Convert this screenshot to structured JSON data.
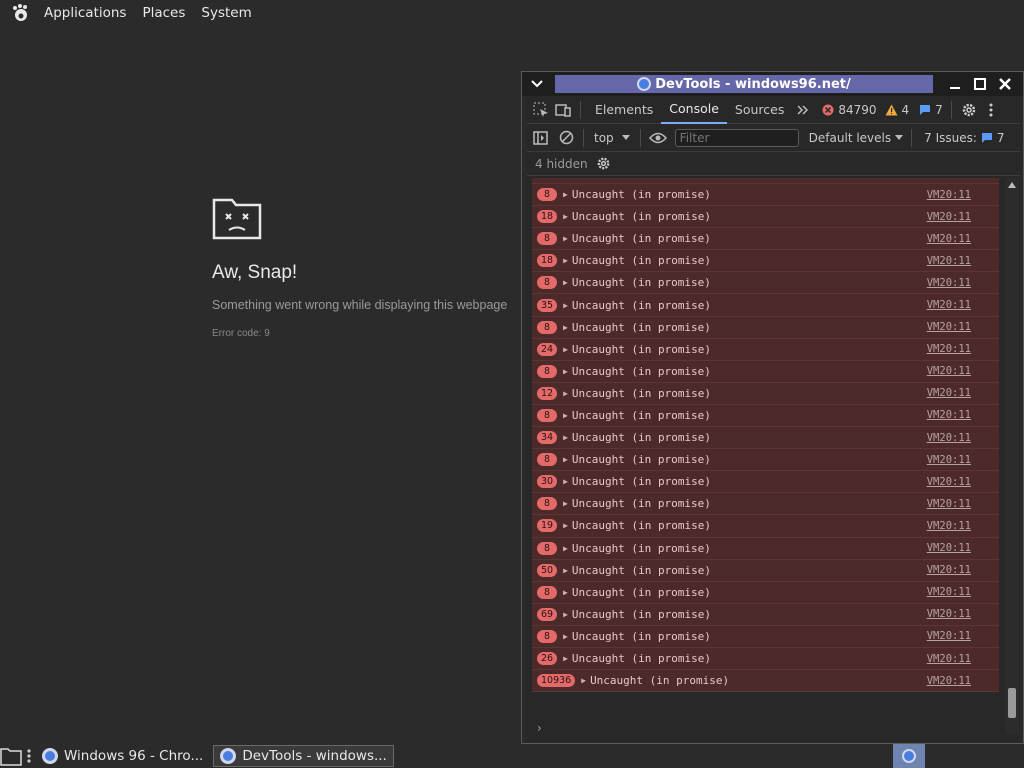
{
  "top_panel": {
    "menus": [
      "Applications",
      "Places",
      "System"
    ]
  },
  "crash_page": {
    "title": "Aw, Snap!",
    "message": "Something went wrong while displaying this webpage",
    "error_code": "Error code: 9"
  },
  "devtools": {
    "window_title": "DevTools - windows96.net/",
    "tabs": [
      "Elements",
      "Console",
      "Sources"
    ],
    "active_tab": "Console",
    "error_count": "84790",
    "warning_count": "4",
    "info_count": "7",
    "context": "top",
    "filter_placeholder": "Filter",
    "default_levels": "Default levels",
    "issues_label": "7 Issues:",
    "issues_count": "7",
    "hidden_label": "4 hidden",
    "messages": [
      {
        "count": "8",
        "text": "Uncaught (in promise)",
        "source": "VM20:11"
      },
      {
        "count": "18",
        "text": "Uncaught (in promise)",
        "source": "VM20:11"
      },
      {
        "count": "8",
        "text": "Uncaught (in promise)",
        "source": "VM20:11"
      },
      {
        "count": "18",
        "text": "Uncaught (in promise)",
        "source": "VM20:11"
      },
      {
        "count": "8",
        "text": "Uncaught (in promise)",
        "source": "VM20:11"
      },
      {
        "count": "35",
        "text": "Uncaught (in promise)",
        "source": "VM20:11"
      },
      {
        "count": "8",
        "text": "Uncaught (in promise)",
        "source": "VM20:11"
      },
      {
        "count": "24",
        "text": "Uncaught (in promise)",
        "source": "VM20:11"
      },
      {
        "count": "8",
        "text": "Uncaught (in promise)",
        "source": "VM20:11"
      },
      {
        "count": "12",
        "text": "Uncaught (in promise)",
        "source": "VM20:11"
      },
      {
        "count": "8",
        "text": "Uncaught (in promise)",
        "source": "VM20:11"
      },
      {
        "count": "34",
        "text": "Uncaught (in promise)",
        "source": "VM20:11"
      },
      {
        "count": "8",
        "text": "Uncaught (in promise)",
        "source": "VM20:11"
      },
      {
        "count": "30",
        "text": "Uncaught (in promise)",
        "source": "VM20:11"
      },
      {
        "count": "8",
        "text": "Uncaught (in promise)",
        "source": "VM20:11"
      },
      {
        "count": "19",
        "text": "Uncaught (in promise)",
        "source": "VM20:11"
      },
      {
        "count": "8",
        "text": "Uncaught (in promise)",
        "source": "VM20:11"
      },
      {
        "count": "50",
        "text": "Uncaught (in promise)",
        "source": "VM20:11"
      },
      {
        "count": "8",
        "text": "Uncaught (in promise)",
        "source": "VM20:11"
      },
      {
        "count": "69",
        "text": "Uncaught (in promise)",
        "source": "VM20:11"
      },
      {
        "count": "8",
        "text": "Uncaught (in promise)",
        "source": "VM20:11"
      },
      {
        "count": "26",
        "text": "Uncaught (in promise)",
        "source": "VM20:11"
      },
      {
        "count": "10936",
        "text": "Uncaught (in promise)",
        "source": "VM20:11"
      }
    ]
  },
  "taskbar": {
    "tasks": [
      {
        "label": "Windows 96 - Chro...",
        "active": false
      },
      {
        "label": "DevTools - windows...",
        "active": true
      }
    ]
  },
  "colors": {
    "accent": "#7cacf8",
    "error_row": "#4d2a2a",
    "error_badge": "#e46a6a",
    "title_highlight": "#6567a8"
  }
}
